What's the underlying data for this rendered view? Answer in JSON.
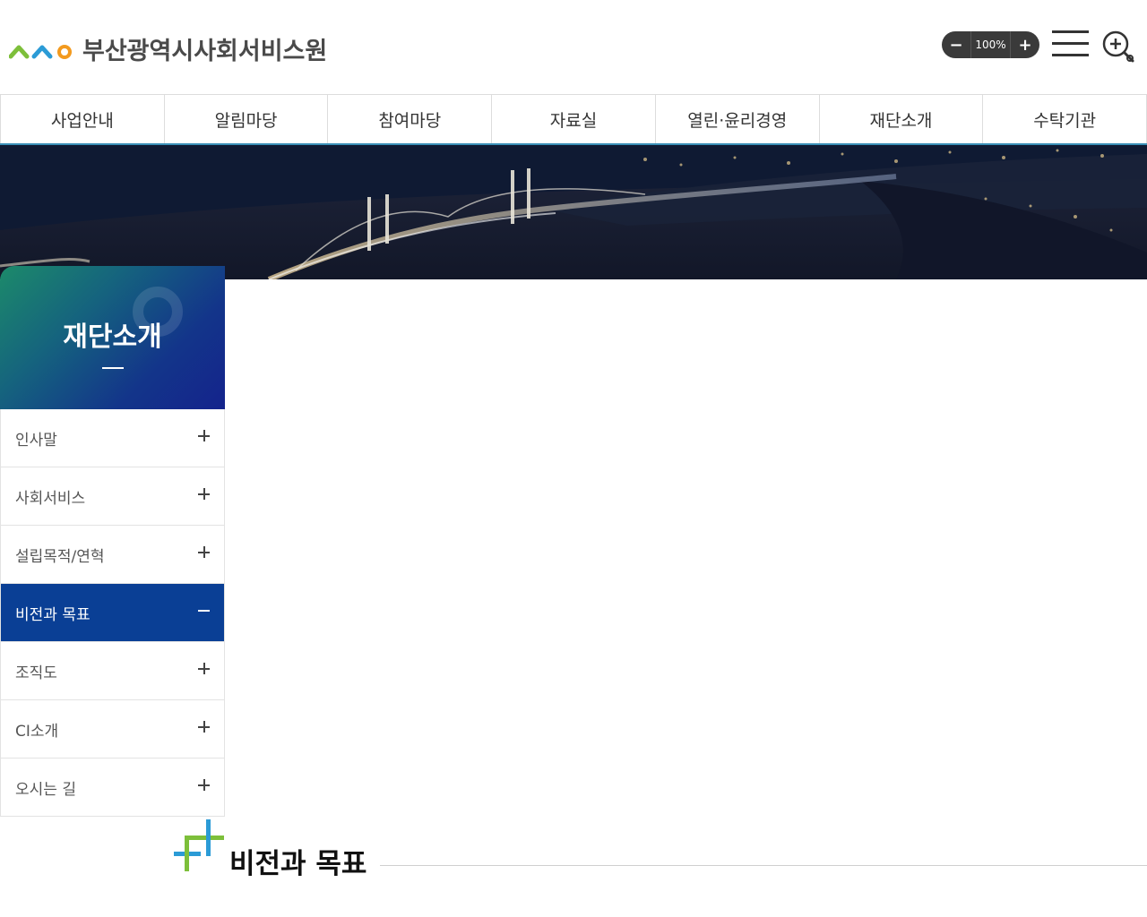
{
  "header": {
    "site_name": "부산광역시사회서비스원",
    "zoom_minus": "−",
    "zoom_level": "100%",
    "zoom_plus": "+"
  },
  "gnb": {
    "items": [
      "사업안내",
      "알림마당",
      "참여마당",
      "자료실",
      "열린·윤리경영",
      "재단소개",
      "수탁기관"
    ]
  },
  "side": {
    "title": "재단소개",
    "items": [
      {
        "label": "인사말",
        "state": "closed"
      },
      {
        "label": "사회서비스",
        "state": "closed"
      },
      {
        "label": "설립목적/연혁",
        "state": "closed"
      },
      {
        "label": "비전과 목표",
        "state": "open"
      },
      {
        "label": "조직도",
        "state": "closed"
      },
      {
        "label": "CI소개",
        "state": "closed"
      },
      {
        "label": "오시는 길",
        "state": "closed"
      }
    ]
  },
  "content": {
    "page_title": "비전과 목표"
  },
  "colors": {
    "accent": "#0a3f95",
    "gnb_border": "#3a8fb7",
    "logo_green": "#7dbf3a",
    "logo_blue": "#2b9bd6",
    "logo_orange": "#f39a1e"
  }
}
